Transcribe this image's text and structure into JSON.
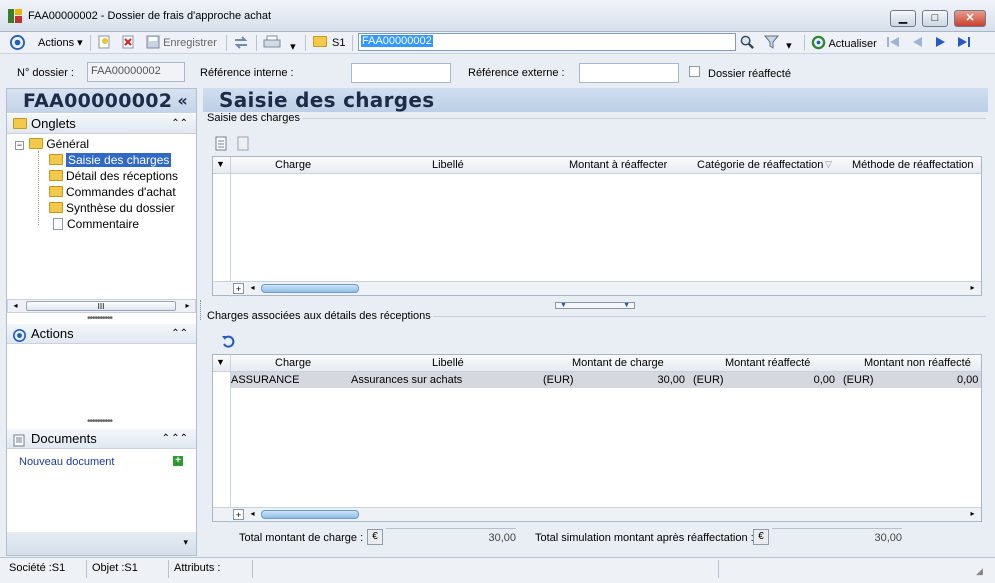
{
  "window": {
    "title": "FAA00000002 -  Dossier de frais d'approche achat",
    "minimize": "▁",
    "maximize": "□",
    "close": "✕"
  },
  "toolbar": {
    "actions_label": "Actions",
    "save_label": "Enregistrer",
    "s1_label": "S1",
    "search_value": "FAA00000002",
    "refresh_label": "Actualiser"
  },
  "header": {
    "dossier_label": "N° dossier :",
    "dossier_value": "FAA00000002",
    "ref_interne_label": "Référence interne :",
    "ref_interne_value": "",
    "ref_externe_label": "Référence externe :",
    "ref_externe_value": "",
    "reaffecte_label": "Dossier réaffecté"
  },
  "left": {
    "title": "FAA00000002",
    "collapse": "«",
    "onglets_label": "Onglets",
    "tree_root": "Général",
    "tree_items": [
      "Saisie des charges",
      "Détail des réceptions",
      "Commandes d'achat",
      "Synthèse du dossier",
      "Commentaire"
    ],
    "actions_label": "Actions",
    "documents_label": "Documents",
    "new_document": "Nouveau document"
  },
  "main": {
    "title": "Saisie des charges",
    "group1_label": "Saisie des charges",
    "grid1_headers": [
      "Charge",
      "Libellé",
      "Montant à réaffecter",
      "Catégorie de réaffectation",
      "Méthode de réaffectation"
    ],
    "group2_label": "Charges associées aux détails des réceptions",
    "grid2_headers": [
      "Charge",
      "Libellé",
      "Montant de charge",
      "Montant réaffecté",
      "Montant non réaffecté"
    ],
    "grid2_rows": [
      {
        "charge": "ASSURANCE",
        "libelle": "Assurances  sur  achats",
        "cur1": "(EUR)",
        "montant": "30,00",
        "cur2": "(EUR)",
        "reaffecte": "0,00",
        "cur3": "(EUR)",
        "non_reaffecte": "0,00"
      }
    ],
    "total_label": "Total montant de charge :",
    "total_value": "30,00",
    "total_sim_label": "Total simulation montant après réaffectation :",
    "total_sim_value": "30,00"
  },
  "status": {
    "societe": "Société :S1",
    "objet": "Objet :S1",
    "attributs": "Attributs :"
  }
}
